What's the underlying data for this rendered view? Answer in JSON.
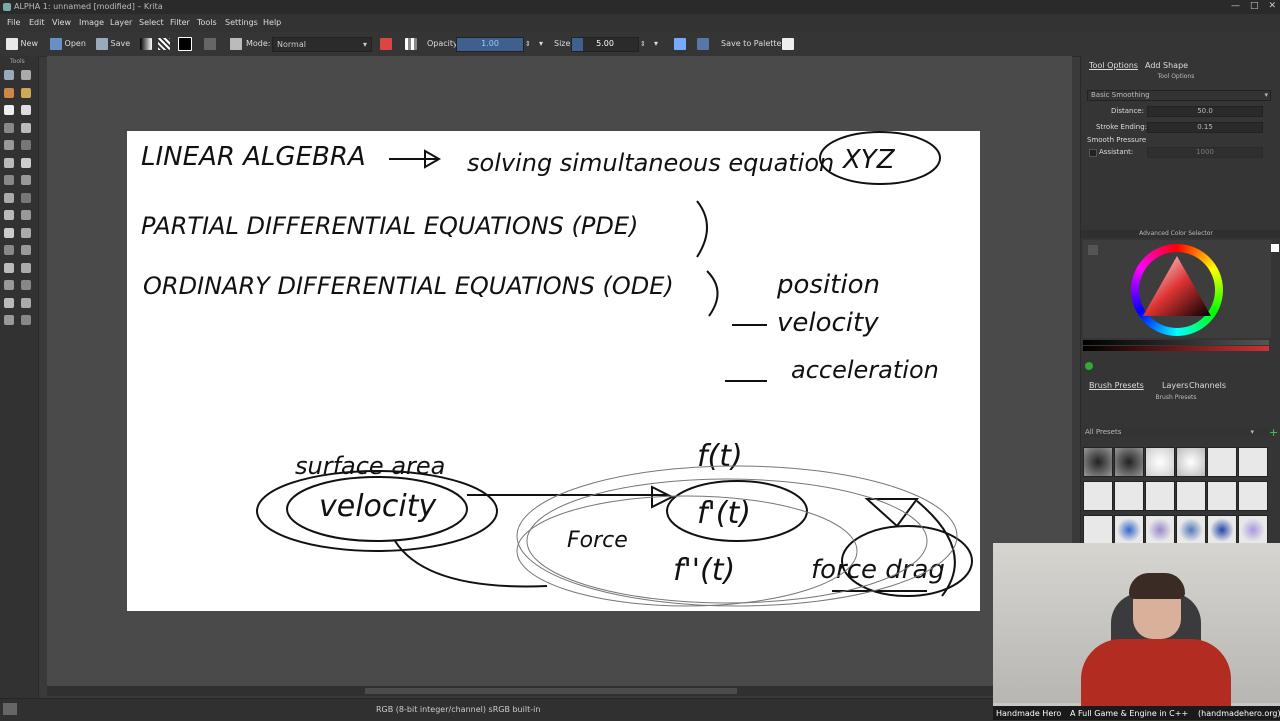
{
  "window": {
    "title": "ALPHA 1: unnamed [modified] – Krita"
  },
  "menu": [
    "File",
    "Edit",
    "View",
    "Image",
    "Layer",
    "Select",
    "Filter",
    "Tools",
    "Settings",
    "Help"
  ],
  "toolbar": {
    "new_label": "New",
    "open_label": "Open",
    "save_label": "Save",
    "mode_label": "Mode:",
    "mode_value": "Normal",
    "opacity_label": "Opacity:",
    "opacity_value": "1.00",
    "size_label": "Size:",
    "size_value": "5.00",
    "save_to_palette_label": "Save to Palette"
  },
  "toolbox": {
    "header": "Tools"
  },
  "right_dock": {
    "tabs": [
      "Tool Options",
      "Add Shape"
    ],
    "tool_options_header": "Tool Options",
    "smoothing_value": "Basic Smoothing",
    "distance_label": "Distance:",
    "distance_value": "50.0",
    "stroke_ending_label": "Stroke Ending:",
    "stroke_ending_value": "0.15",
    "smooth_pressure_label": "Smooth Pressure",
    "assistant_label": "Assistant:",
    "assistant_value": "1000",
    "color_selector_header": "Advanced Color Selector",
    "bottom_tabs": [
      "Brush Presets",
      "Layers",
      "Channels"
    ],
    "brush_presets_header": "Brush Presets",
    "presets_filter": "All Presets"
  },
  "canvas_text": {
    "line1": "LINEAR ALGEBRA",
    "line1b": "solving simultaneous equation",
    "line1c": "XYZ",
    "line2": "PARTIAL DIFFERENTIAL EQUATIONS (PDE)",
    "line3": "ORDINARY DIFFERENTIAL EQUATIONS (ODE)",
    "position": "position",
    "velocity_right": "velocity",
    "acceleration": "acceleration",
    "surface_area": "surface area",
    "velocity": "velocity",
    "f_t": "f(t)",
    "f_prime": "f'(t)",
    "f_double_prime": "f''(t)",
    "force": "Force",
    "force_drag": "force drag"
  },
  "statusbar": {
    "text": "RGB (8-bit integer/channel)  sRGB built-in"
  },
  "webcam": {
    "left": "Handmade Hero",
    "middle": "A Full Game & Engine in C++",
    "right": "(handmadehero.org)"
  },
  "colors": {
    "accent": "#3f5f8f",
    "ui_bg": "#353535",
    "canvas_bg": "#4a4a4a"
  }
}
